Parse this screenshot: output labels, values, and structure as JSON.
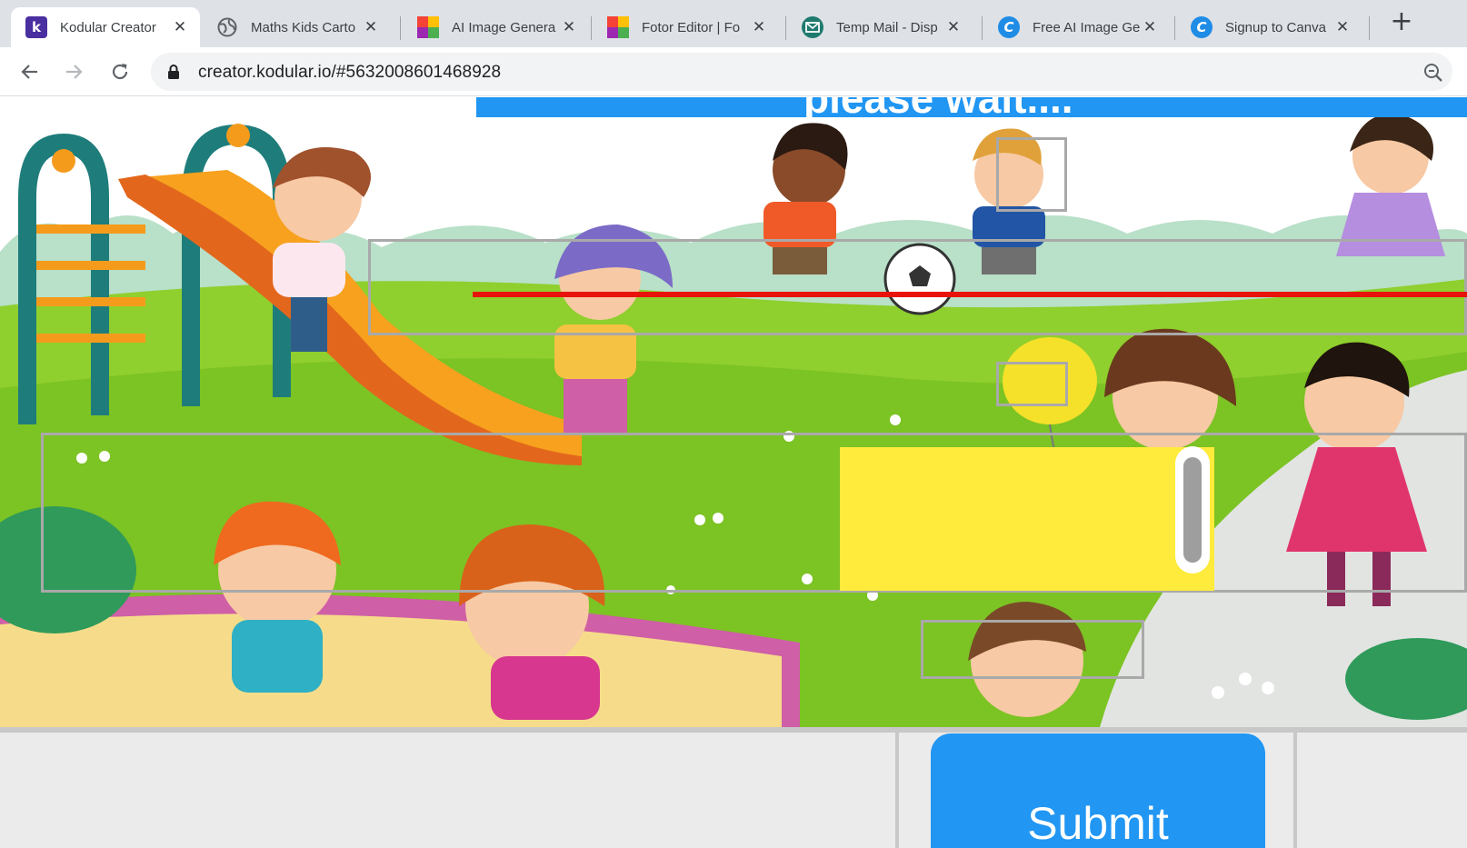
{
  "browser": {
    "tabs": [
      {
        "title": "Kodular Creator",
        "icon": "kodular-logo-icon",
        "color": "#4a2fa0",
        "glyph": "k"
      },
      {
        "title": "Maths Kids Carto",
        "icon": "globe-icon",
        "color": "#5f6368",
        "glyph": ""
      },
      {
        "title": "AI Image Genera",
        "icon": "fotor-logo-icon",
        "color": "#f6b400",
        "glyph": ""
      },
      {
        "title": "Fotor Editor | Fo",
        "icon": "fotor-logo-icon",
        "color": "#f6b400",
        "glyph": ""
      },
      {
        "title": "Temp Mail - Disp",
        "icon": "temp-mail-icon",
        "color": "#1f7a6e",
        "glyph": ""
      },
      {
        "title": "Free AI Image Ge",
        "icon": "canva-logo-icon",
        "color": "#1f8ce6",
        "glyph": "C"
      },
      {
        "title": "Signup to Canva",
        "icon": "canva-logo-icon",
        "color": "#1f8ce6",
        "glyph": "C"
      }
    ],
    "new_tab_label": "+",
    "close_glyph": "✕",
    "url": "creator.kodular.io/#5632008601468928"
  },
  "app": {
    "banner_text": "please wait....",
    "submit_label": "Submit",
    "accent_color": "#2196f3",
    "highlight_color": "#ffeb3b"
  }
}
